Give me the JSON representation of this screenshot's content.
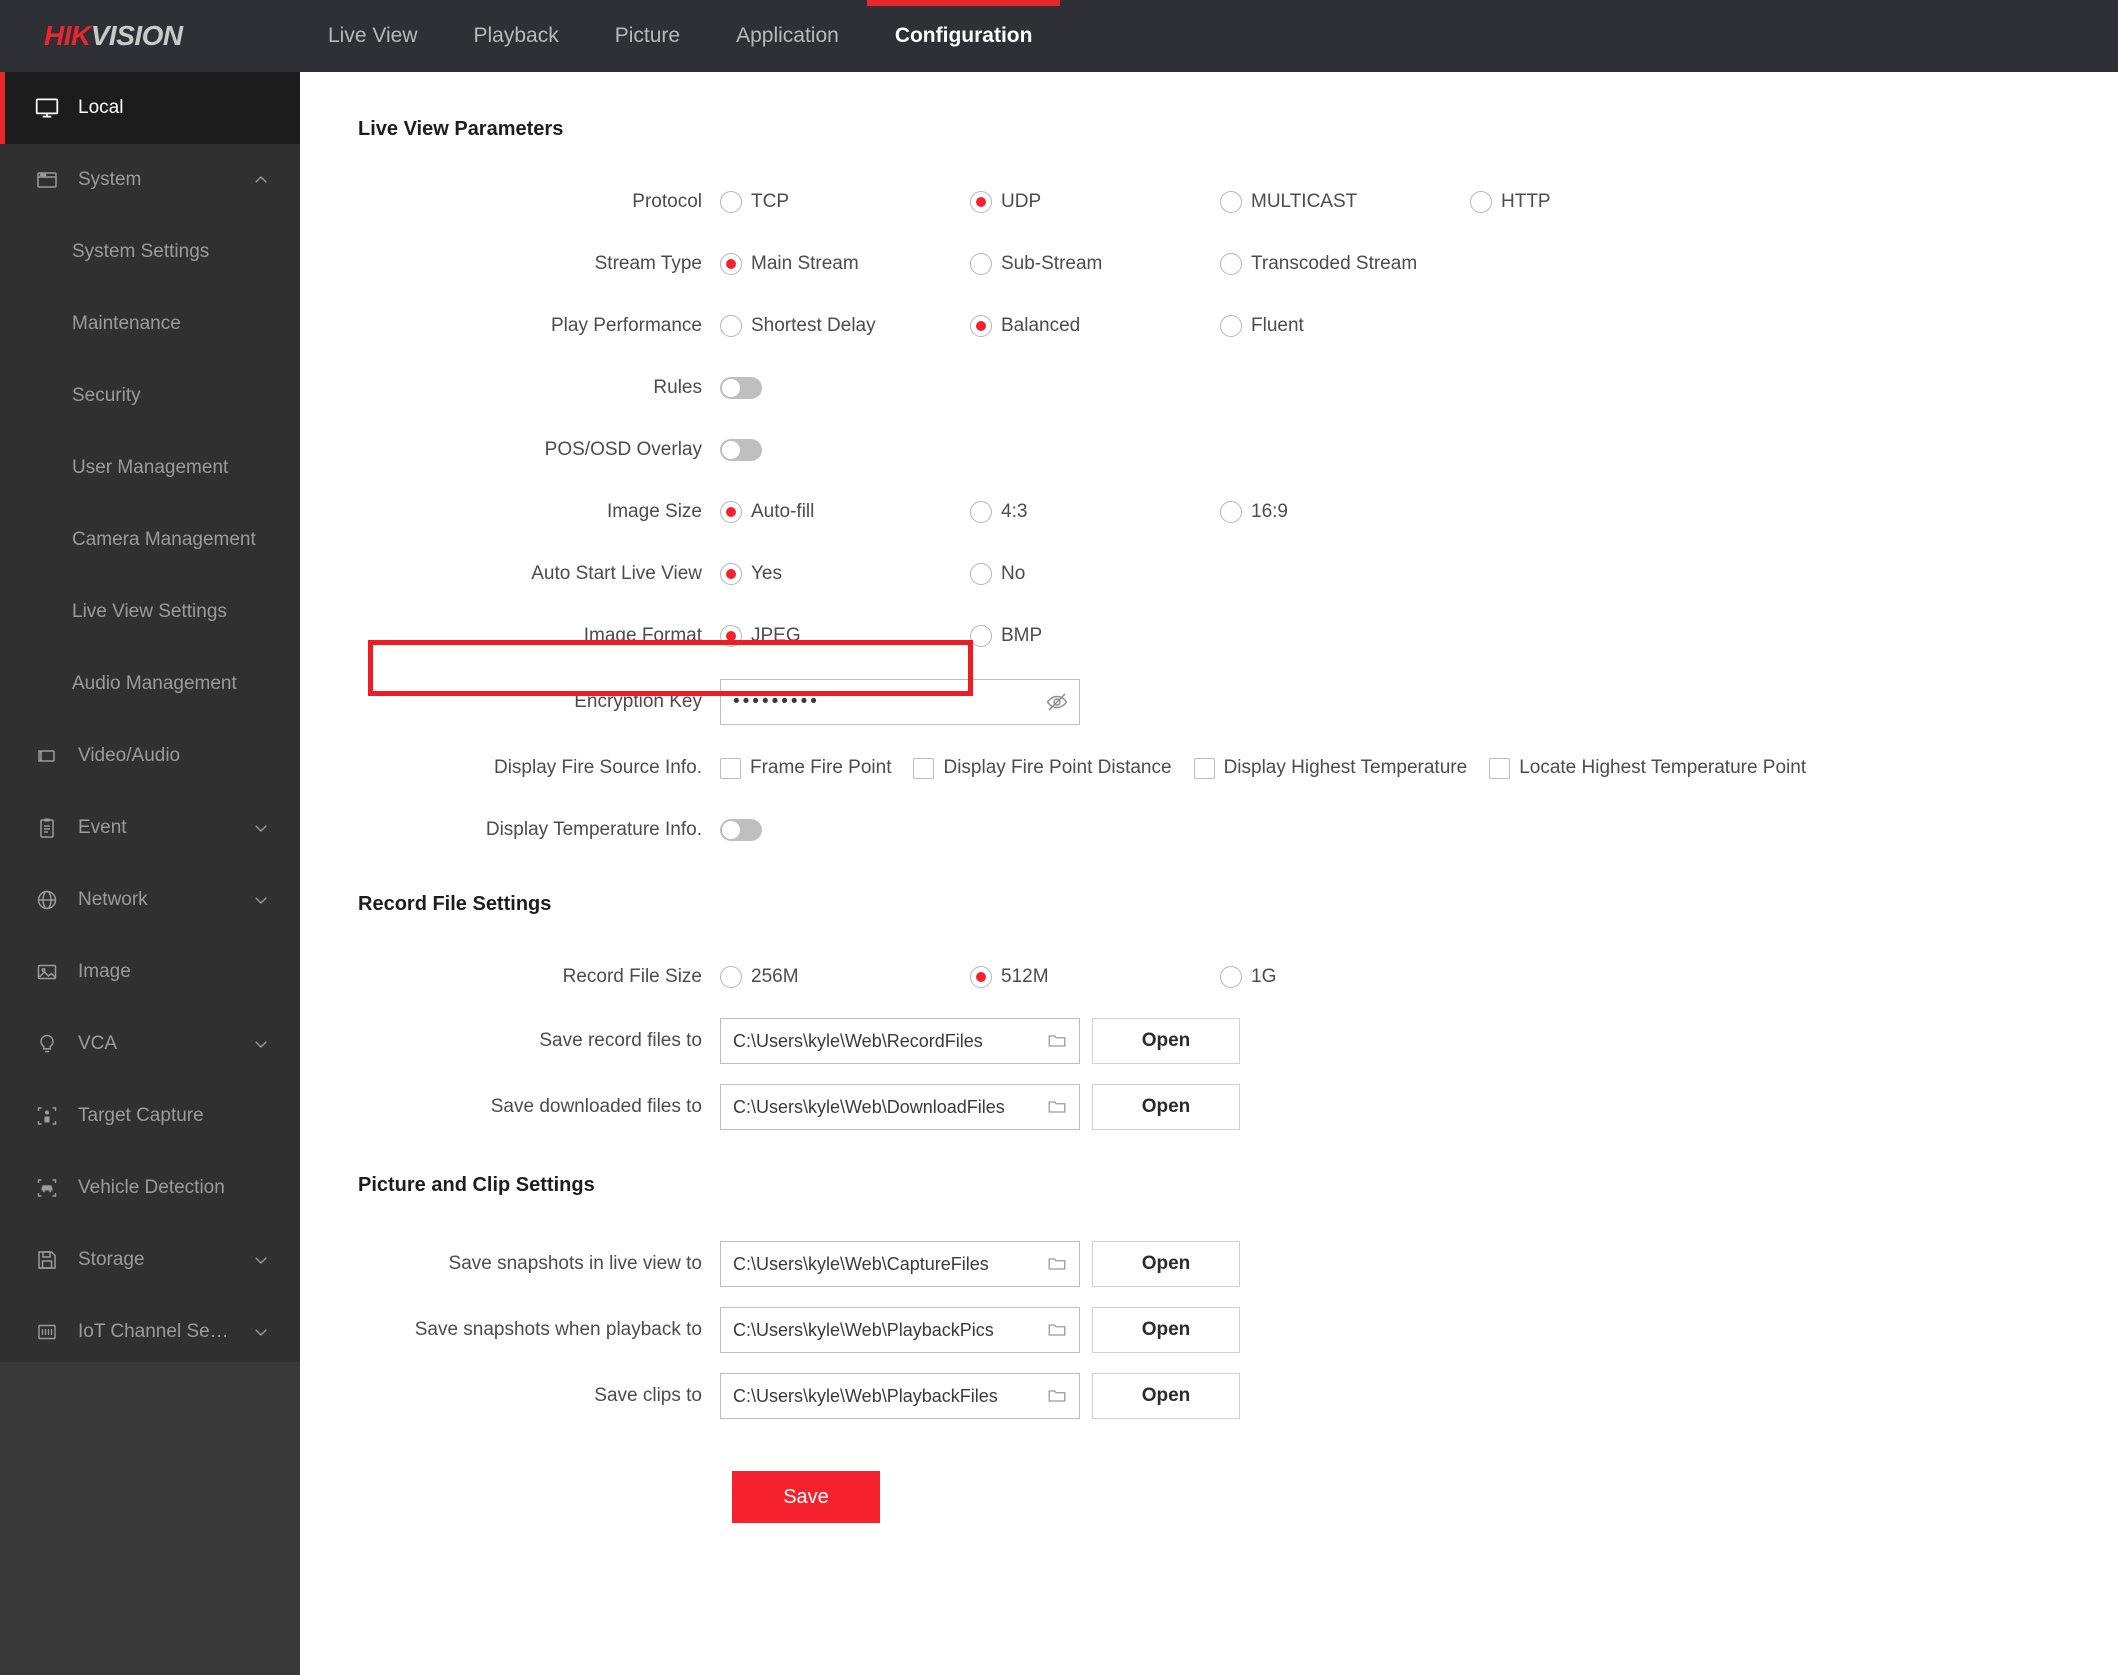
{
  "brand": {
    "first": "HIK",
    "second": "VISION"
  },
  "nav": {
    "tabs": [
      {
        "label": "Live View",
        "active": false
      },
      {
        "label": "Playback",
        "active": false
      },
      {
        "label": "Picture",
        "active": false
      },
      {
        "label": "Application",
        "active": false
      },
      {
        "label": "Configuration",
        "active": true
      }
    ]
  },
  "sidebar": {
    "items": [
      {
        "label": "Local",
        "icon": "monitor-icon",
        "active": true
      },
      {
        "label": "System",
        "icon": "window-icon",
        "caret": "chevron-up-icon"
      },
      {
        "label": "System Settings",
        "sub": true
      },
      {
        "label": "Maintenance",
        "sub": true
      },
      {
        "label": "Security",
        "sub": true
      },
      {
        "label": "User Management",
        "sub": true
      },
      {
        "label": "Camera Management",
        "sub": true
      },
      {
        "label": "Live View Settings",
        "sub": true
      },
      {
        "label": "Audio Management",
        "sub": true
      },
      {
        "label": "Video/Audio",
        "icon": "camera-icon"
      },
      {
        "label": "Event",
        "icon": "clipboard-icon",
        "caret": "chevron-down-icon"
      },
      {
        "label": "Network",
        "icon": "globe-icon",
        "caret": "chevron-down-icon"
      },
      {
        "label": "Image",
        "icon": "picture-icon"
      },
      {
        "label": "VCA",
        "icon": "bulb-icon",
        "caret": "chevron-down-icon"
      },
      {
        "label": "Target Capture",
        "icon": "person-frame-icon"
      },
      {
        "label": "Vehicle Detection",
        "icon": "car-frame-icon"
      },
      {
        "label": "Storage",
        "icon": "floppy-icon",
        "caret": "chevron-down-icon"
      },
      {
        "label": "IoT Channel Se…",
        "icon": "iot-icon",
        "caret": "chevron-down-icon"
      }
    ]
  },
  "sections": {
    "live_view": {
      "title": "Live View Parameters",
      "protocol": {
        "label": "Protocol",
        "options": [
          {
            "label": "TCP",
            "selected": false
          },
          {
            "label": "UDP",
            "selected": true
          },
          {
            "label": "MULTICAST",
            "selected": false
          },
          {
            "label": "HTTP",
            "selected": false
          }
        ]
      },
      "stream_type": {
        "label": "Stream Type",
        "options": [
          {
            "label": "Main Stream",
            "selected": true
          },
          {
            "label": "Sub-Stream",
            "selected": false
          },
          {
            "label": "Transcoded Stream",
            "selected": false
          }
        ]
      },
      "play_performance": {
        "label": "Play Performance",
        "options": [
          {
            "label": "Shortest Delay",
            "selected": false
          },
          {
            "label": "Balanced",
            "selected": true
          },
          {
            "label": "Fluent",
            "selected": false
          }
        ]
      },
      "rules": {
        "label": "Rules",
        "on": false
      },
      "pos_osd_overlay": {
        "label": "POS/OSD Overlay",
        "on": false
      },
      "image_size": {
        "label": "Image Size",
        "options": [
          {
            "label": "Auto-fill",
            "selected": true
          },
          {
            "label": "4:3",
            "selected": false
          },
          {
            "label": "16:9",
            "selected": false
          }
        ]
      },
      "auto_start_live_view": {
        "label": "Auto Start Live View",
        "options": [
          {
            "label": "Yes",
            "selected": true
          },
          {
            "label": "No",
            "selected": false
          }
        ]
      },
      "image_format": {
        "label": "Image Format",
        "options": [
          {
            "label": "JPEG",
            "selected": true
          },
          {
            "label": "BMP",
            "selected": false
          }
        ]
      },
      "encryption_key": {
        "label": "Encryption Key",
        "value": "•••••••••",
        "icon": "eye-off-icon"
      },
      "display_fire_source_info": {
        "label": "Display Fire Source Info.",
        "options": [
          {
            "label": "Frame Fire Point",
            "checked": false
          },
          {
            "label": "Display Fire Point Distance",
            "checked": false
          },
          {
            "label": "Display Highest Temperature",
            "checked": false
          },
          {
            "label": "Locate Highest Temperature Point",
            "checked": false
          }
        ]
      },
      "display_temperature_info": {
        "label": "Display Temperature Info.",
        "on": false
      }
    },
    "record_file": {
      "title": "Record File Settings",
      "record_file_size": {
        "label": "Record File Size",
        "options": [
          {
            "label": "256M",
            "selected": false
          },
          {
            "label": "512M",
            "selected": true
          },
          {
            "label": "1G",
            "selected": false
          }
        ]
      },
      "paths": [
        {
          "label": "Save record files to",
          "value": "C:\\Users\\kyle\\Web\\RecordFiles",
          "button": "Open"
        },
        {
          "label": "Save downloaded files to",
          "value": "C:\\Users\\kyle\\Web\\DownloadFiles",
          "button": "Open"
        }
      ]
    },
    "picture_clip": {
      "title": "Picture and Clip Settings",
      "paths": [
        {
          "label": "Save snapshots in live view to",
          "value": "C:\\Users\\kyle\\Web\\CaptureFiles",
          "button": "Open"
        },
        {
          "label": "Save snapshots when playback to",
          "value": "C:\\Users\\kyle\\Web\\PlaybackPics",
          "button": "Open"
        },
        {
          "label": "Save clips to",
          "value": "C:\\Users\\kyle\\Web\\PlaybackFiles",
          "button": "Open"
        }
      ]
    }
  },
  "save_button": {
    "label": "Save"
  },
  "colors": {
    "accent": "#e8272c",
    "highlight": "#ee1c25",
    "save": "#f5222d"
  }
}
